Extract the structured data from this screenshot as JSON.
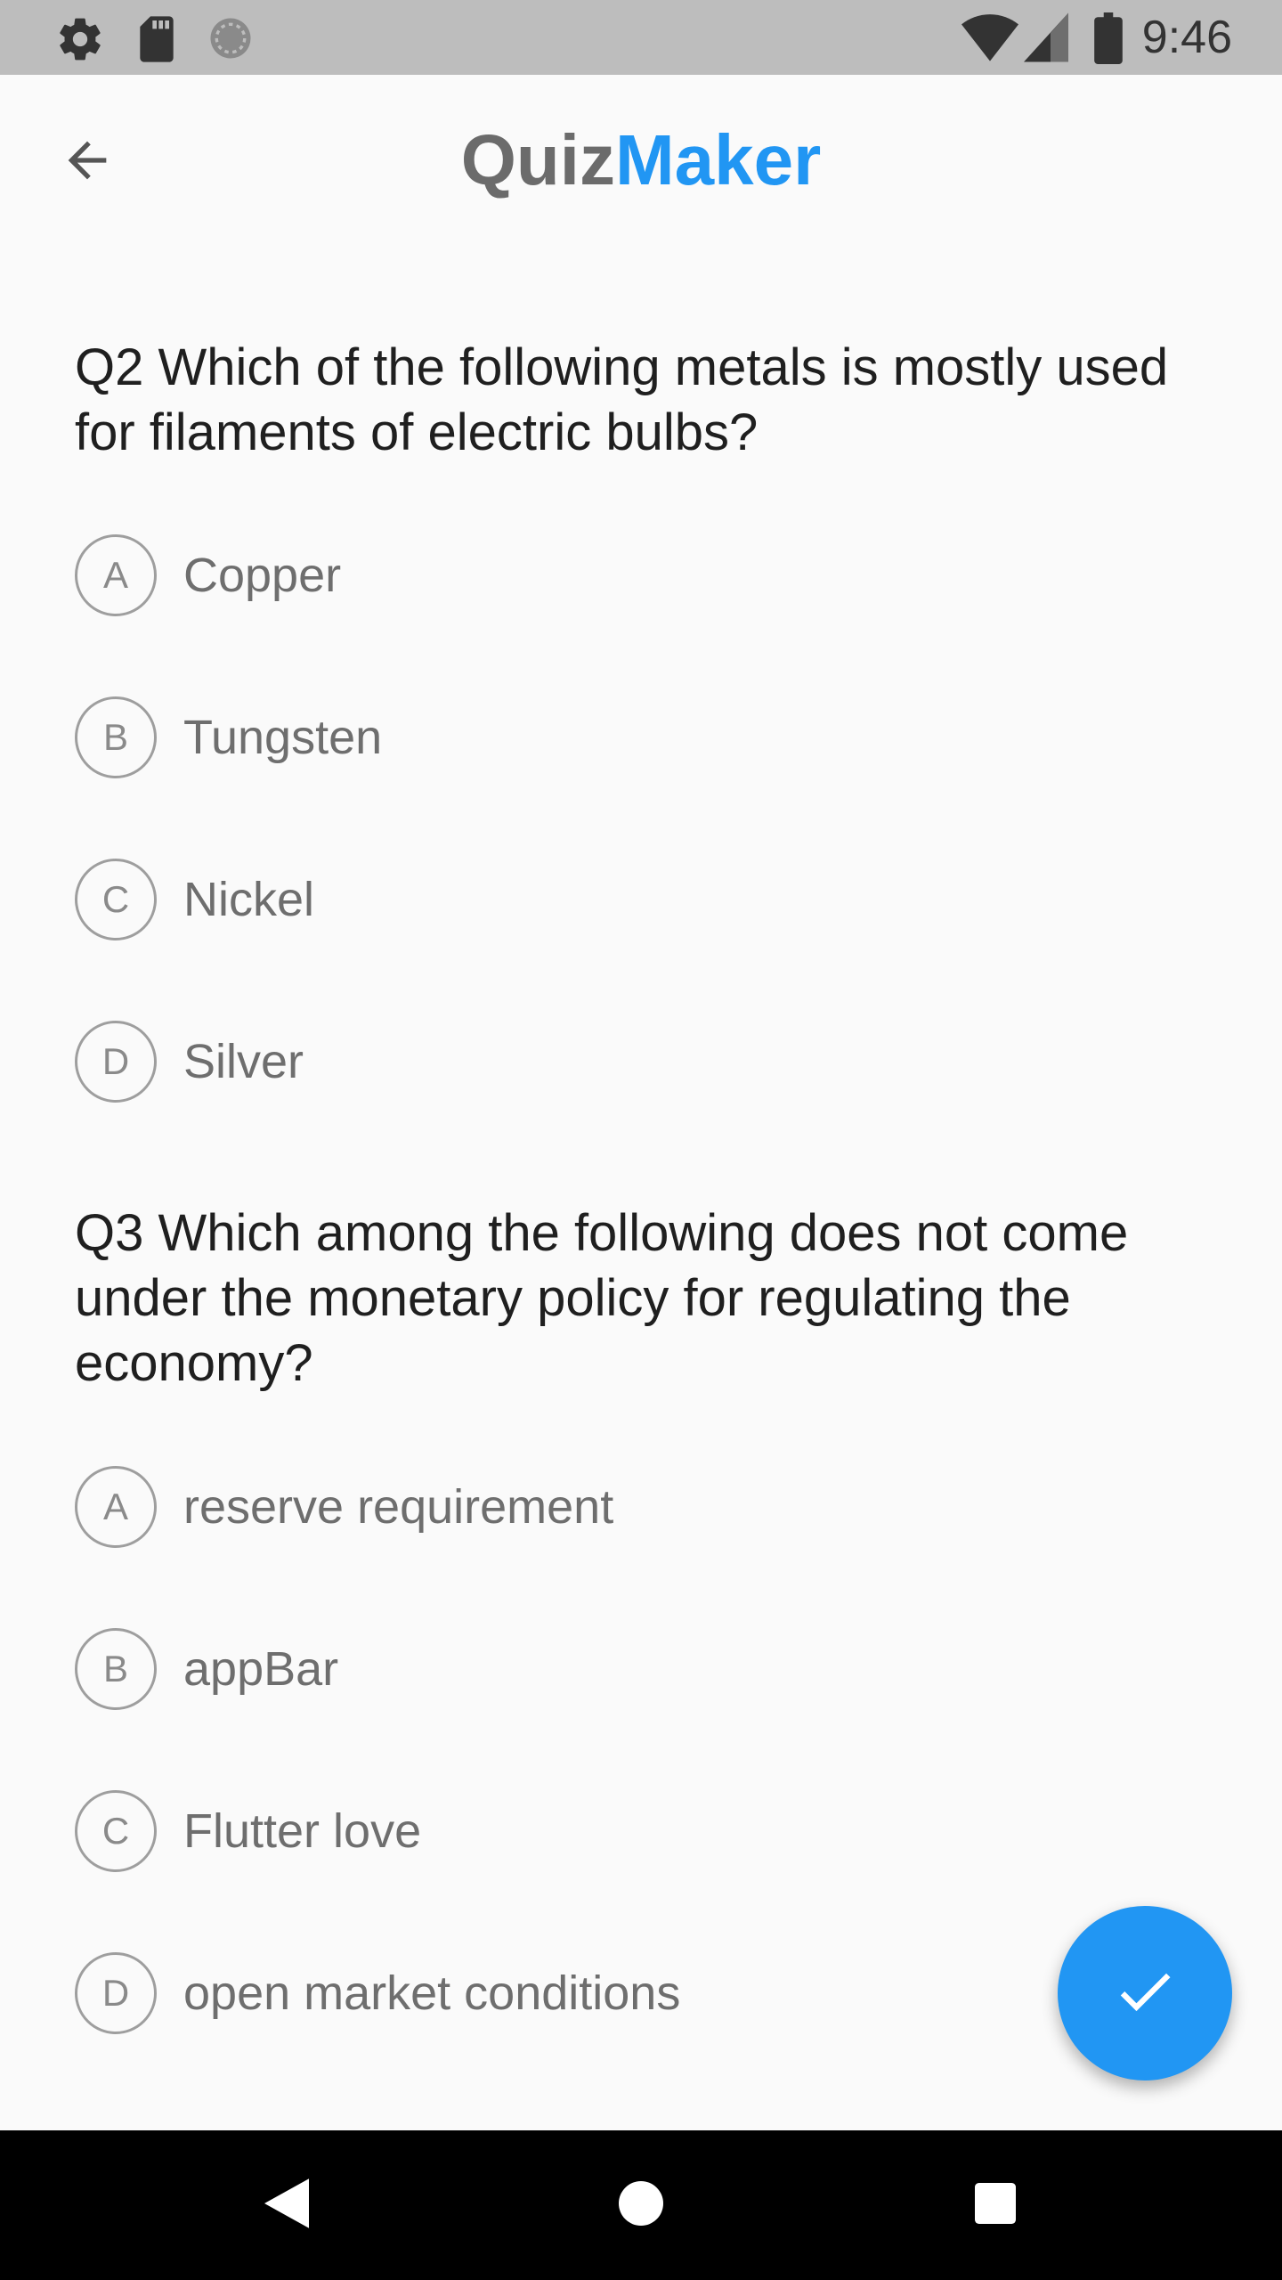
{
  "status_bar": {
    "time": "9:46",
    "left_icons": [
      "gear-icon",
      "sd-card-icon",
      "sync-icon"
    ],
    "right_icons": [
      "wifi-icon",
      "cell-signal-icon",
      "battery-icon"
    ]
  },
  "app_bar": {
    "title_part_1": "Quiz",
    "title_part_2": "Maker",
    "back_icon": "arrow-back-icon"
  },
  "questions": [
    {
      "text": "Q2 Which of the following metals is mostly used for filaments of electric bulbs?",
      "options": [
        {
          "letter": "A",
          "label": "Copper"
        },
        {
          "letter": "B",
          "label": "Tungsten"
        },
        {
          "letter": "C",
          "label": "Nickel"
        },
        {
          "letter": "D",
          "label": "Silver"
        }
      ]
    },
    {
      "text": "Q3 Which among the following does not come under the monetary policy for regulating the economy?",
      "options": [
        {
          "letter": "A",
          "label": "reserve requirement"
        },
        {
          "letter": "B",
          "label": "appBar"
        },
        {
          "letter": "C",
          "label": "Flutter love"
        },
        {
          "letter": "D",
          "label": "open market conditions"
        }
      ]
    }
  ],
  "fab": {
    "icon": "check-icon"
  },
  "nav_bar": {
    "icons": [
      "back-triangle-icon",
      "home-circle-icon",
      "recents-square-icon"
    ]
  },
  "colors": {
    "accent": "#2196f3",
    "status_bar": "#bdbdbd",
    "background": "#fafafa",
    "nav_bar": "#000000"
  }
}
